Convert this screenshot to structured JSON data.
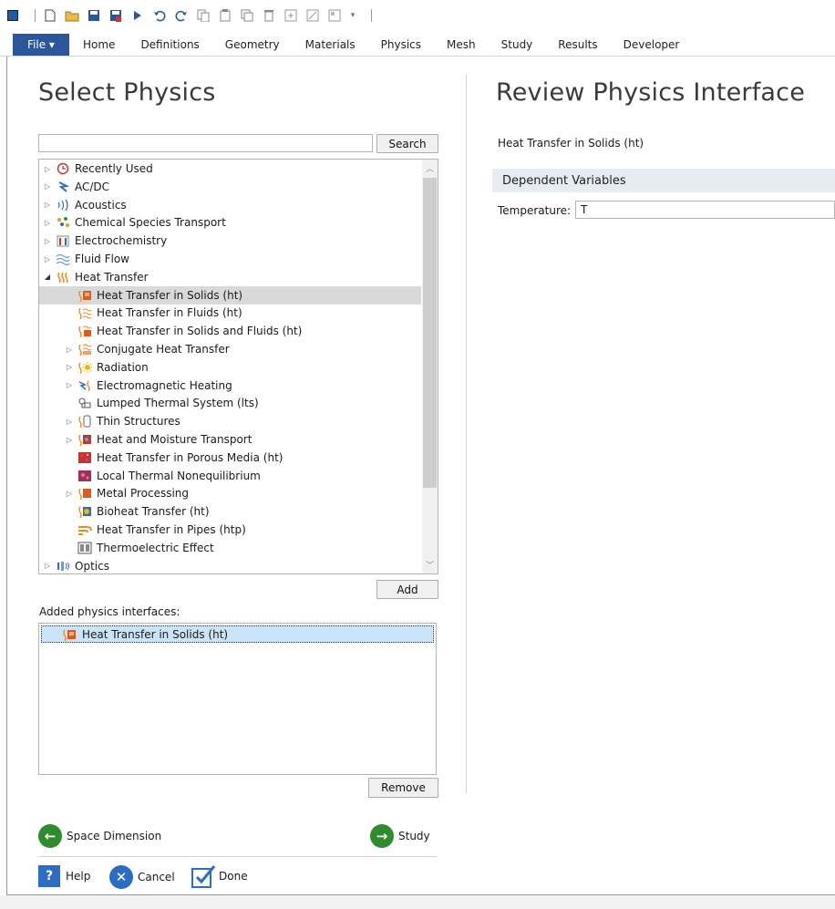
{
  "ribbon": {
    "file_label": "File ▾",
    "tabs": [
      "Home",
      "Definitions",
      "Geometry",
      "Materials",
      "Physics",
      "Mesh",
      "Study",
      "Results",
      "Developer"
    ]
  },
  "left": {
    "title": "Select Physics",
    "search_button": "Search",
    "tree": [
      {
        "label": "Recently Used",
        "icon": "clock-icon",
        "level": 0,
        "toggle": "collapsed"
      },
      {
        "label": "AC/DC",
        "icon": "acdc-icon",
        "level": 0,
        "toggle": "collapsed"
      },
      {
        "label": "Acoustics",
        "icon": "acoustics-icon",
        "level": 0,
        "toggle": "collapsed"
      },
      {
        "label": "Chemical Species Transport",
        "icon": "chemical-icon",
        "level": 0,
        "toggle": "collapsed"
      },
      {
        "label": "Electrochemistry",
        "icon": "electrochemistry-icon",
        "level": 0,
        "toggle": "collapsed"
      },
      {
        "label": "Fluid Flow",
        "icon": "fluid-flow-icon",
        "level": 0,
        "toggle": "collapsed"
      },
      {
        "label": "Heat Transfer",
        "icon": "heat-transfer-icon",
        "level": 0,
        "toggle": "expanded"
      },
      {
        "label": "Heat Transfer in Solids (ht)",
        "icon": "heat-solids-icon",
        "level": 1,
        "toggle": "none",
        "selected": true
      },
      {
        "label": "Heat Transfer in Fluids (ht)",
        "icon": "heat-fluids-icon",
        "level": 1,
        "toggle": "none"
      },
      {
        "label": "Heat Transfer in Solids and Fluids (ht)",
        "icon": "heat-solids-fluids-icon",
        "level": 1,
        "toggle": "none"
      },
      {
        "label": "Conjugate Heat Transfer",
        "icon": "conjugate-icon",
        "level": 1,
        "toggle": "collapsed"
      },
      {
        "label": "Radiation",
        "icon": "radiation-icon",
        "level": 1,
        "toggle": "collapsed"
      },
      {
        "label": "Electromagnetic Heating",
        "icon": "em-heating-icon",
        "level": 1,
        "toggle": "collapsed"
      },
      {
        "label": "Lumped Thermal System (lts)",
        "icon": "lumped-icon",
        "level": 1,
        "toggle": "none"
      },
      {
        "label": "Thin Structures",
        "icon": "thin-structures-icon",
        "level": 1,
        "toggle": "collapsed"
      },
      {
        "label": "Heat and Moisture Transport",
        "icon": "moisture-icon",
        "level": 1,
        "toggle": "collapsed"
      },
      {
        "label": "Heat Transfer in Porous Media (ht)",
        "icon": "porous-icon",
        "level": 1,
        "toggle": "none"
      },
      {
        "label": "Local Thermal Nonequilibrium",
        "icon": "nonequilibrium-icon",
        "level": 1,
        "toggle": "none"
      },
      {
        "label": "Metal Processing",
        "icon": "metal-icon",
        "level": 1,
        "toggle": "collapsed"
      },
      {
        "label": "Bioheat Transfer (ht)",
        "icon": "bioheat-icon",
        "level": 1,
        "toggle": "none"
      },
      {
        "label": "Heat Transfer in Pipes (htp)",
        "icon": "pipes-icon",
        "level": 1,
        "toggle": "none"
      },
      {
        "label": "Thermoelectric Effect",
        "icon": "thermoelectric-icon",
        "level": 1,
        "toggle": "none"
      },
      {
        "label": "Optics",
        "icon": "optics-icon",
        "level": 0,
        "toggle": "collapsed"
      }
    ],
    "add_button": "Add",
    "added_label": "Added physics interfaces:",
    "added_items": [
      "Heat Transfer in Solids (ht)"
    ],
    "remove_button": "Remove",
    "back_label": "Space Dimension",
    "next_label": "Study",
    "help_label": "Help",
    "cancel_label": "Cancel",
    "done_label": "Done"
  },
  "right": {
    "title": "Review Physics Interface",
    "interface_name": "Heat Transfer in Solids (ht)",
    "section_header": "Dependent Variables",
    "temperature_label": "Temperature:",
    "temperature_value": "T"
  },
  "colors": {
    "file_tab": "#2b579a",
    "selected_row": "#d9d9d9",
    "added_selected": "#cce4f7",
    "nav_green": "#2e8b2e",
    "cancel_blue": "#2b6cc4",
    "heat_orange": "#f08a24"
  }
}
